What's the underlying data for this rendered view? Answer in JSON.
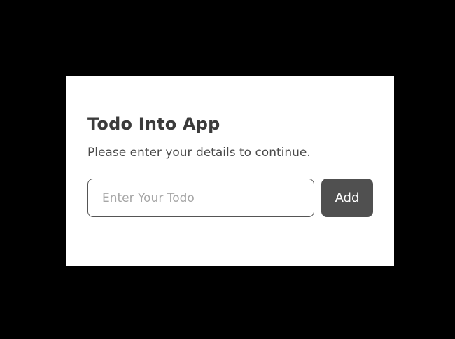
{
  "card": {
    "title": "Todo Into App",
    "subtitle": "Please enter your details to continue.",
    "todo_input": {
      "value": "",
      "placeholder": "Enter Your Todo"
    },
    "add_button_label": "Add"
  },
  "colors": {
    "page_background": "#000000",
    "card_background": "#ffffff",
    "title_text": "#3b3b3b",
    "button_background": "#505050",
    "button_text": "#ffffff",
    "input_border": "#555555",
    "placeholder_text": "#a6a6a6"
  }
}
